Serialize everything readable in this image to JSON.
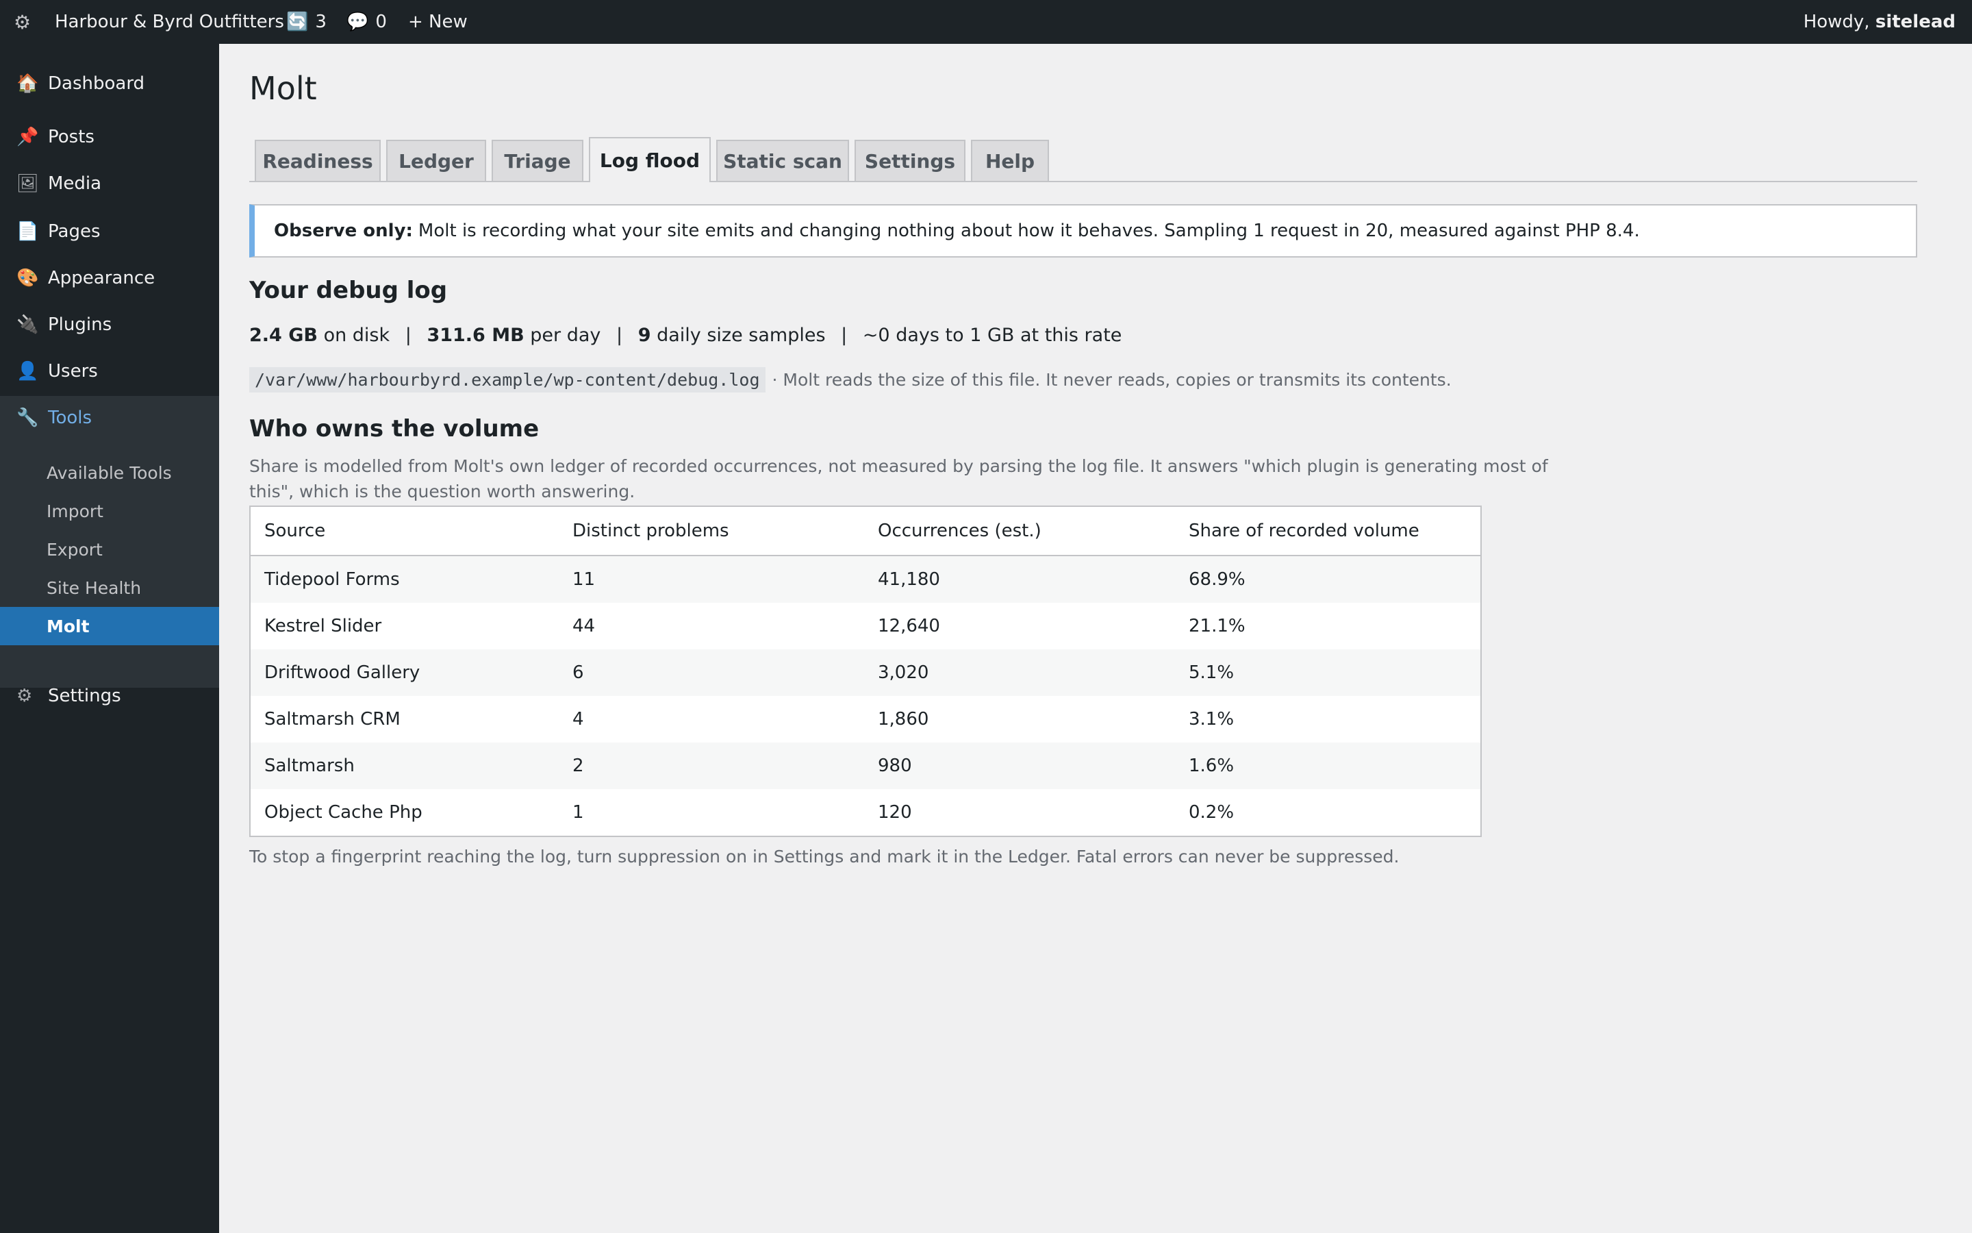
{
  "adminbar": {
    "wp_icon": "⚙",
    "site_name": "Harbour & Byrd Outfitters",
    "updates_icon": "🔄",
    "updates_count": "3",
    "comments_icon": "💬",
    "comments_count": "0",
    "new_label": "+ New",
    "howdy_prefix": "Howdy, ",
    "username": "sitelead"
  },
  "sidebar": {
    "items": [
      {
        "label": "Dashboard",
        "icon": "🏠"
      },
      {
        "label": "Posts",
        "icon": "📌"
      },
      {
        "label": "Media",
        "icon": "🖼"
      },
      {
        "label": "Pages",
        "icon": "📄"
      },
      {
        "label": "Appearance",
        "icon": "🎨"
      },
      {
        "label": "Plugins",
        "icon": "🔌"
      },
      {
        "label": "Users",
        "icon": "👤"
      },
      {
        "label": "Tools",
        "icon": "🔧"
      },
      {
        "label": "Settings",
        "icon": "⚙"
      }
    ],
    "tools_submenu": [
      "Available Tools",
      "Import",
      "Export",
      "Site Health",
      "Molt"
    ]
  },
  "page": {
    "title": "Molt",
    "tabs": [
      "Readiness",
      "Ledger",
      "Triage",
      "Log flood",
      "Static scan",
      "Settings",
      "Help"
    ],
    "active_tab": "Log flood",
    "notice": {
      "label": "Observe only:",
      "text": "Molt is recording what your site emits and changing nothing about how it behaves. Sampling 1 request in 20, measured against PHP 8.4."
    },
    "debug_log": {
      "heading": "Your debug log",
      "size": "2.4 GB",
      "size_suffix": "on disk",
      "rate": "311.6 MB",
      "rate_suffix": "per day",
      "samples": "9",
      "samples_suffix": "daily size samples",
      "projection": "~0 days to 1 GB at this rate",
      "separator": "|",
      "path": "/var/www/harbourbyrd.example/wp-content/debug.log",
      "path_note": "· Molt reads the size of this file. It never reads, copies or transmits its contents."
    },
    "volume": {
      "heading": "Who owns the volume",
      "description": "Share is modelled from Molt's own ledger of recorded occurrences, not measured by parsing the log file. It answers \"which plugin is generating most of this\", which is the question worth answering.",
      "columns": [
        "Source",
        "Distinct problems",
        "Occurrences (est.)",
        "Share of recorded volume"
      ],
      "rows": [
        [
          "Tidepool Forms",
          "11",
          "41,180",
          "68.9%"
        ],
        [
          "Kestrel Slider",
          "44",
          "12,640",
          "21.1%"
        ],
        [
          "Driftwood Gallery",
          "6",
          "3,020",
          "5.1%"
        ],
        [
          "Saltmarsh CRM",
          "4",
          "1,860",
          "3.1%"
        ],
        [
          "Saltmarsh",
          "2",
          "980",
          "1.6%"
        ],
        [
          "Object Cache Php",
          "1",
          "120",
          "0.2%"
        ]
      ],
      "footnote": "To stop a fingerprint reaching the log, turn suppression on in Settings and mark it in the Ledger. Fatal errors can never be suppressed."
    }
  },
  "colors": {
    "adminbar_bg": "#1d2327",
    "accent": "#2271b1",
    "notice_border": "#72aee6"
  }
}
